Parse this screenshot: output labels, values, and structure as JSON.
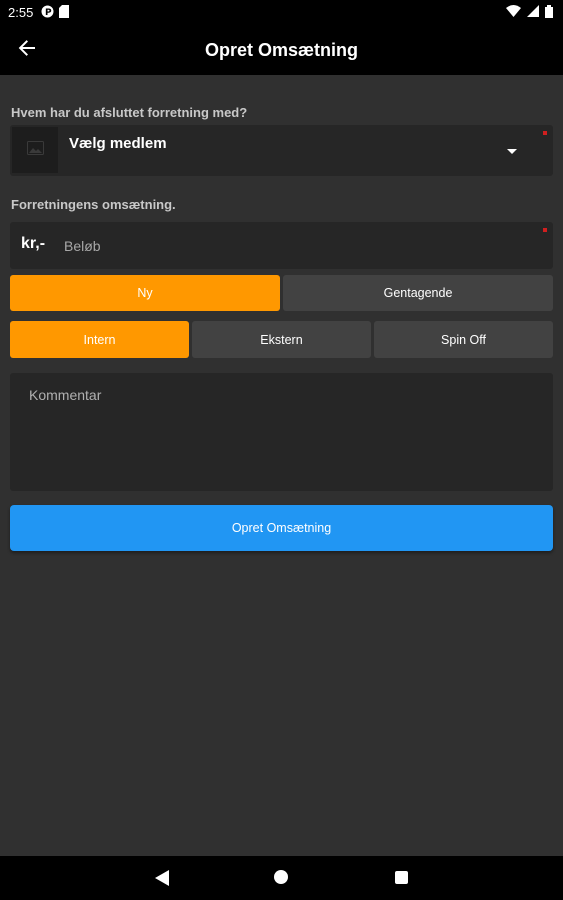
{
  "status_bar": {
    "time": "2:55",
    "icons": [
      "notification-p-icon",
      "sd-card-icon",
      "wifi-icon",
      "signal-icon",
      "battery-icon"
    ]
  },
  "app_bar": {
    "title": "Opret Omsætning",
    "back_icon": "arrow-back-icon"
  },
  "member": {
    "label": "Hvem har du afsluttet forretning med?",
    "select_text": "Vælg medlem",
    "required": true
  },
  "amount": {
    "label": "Forretningens omsætning.",
    "prefix": "kr,-",
    "placeholder": "Beløb",
    "value": "",
    "required": true
  },
  "type_toggle": {
    "options": [
      "Ny",
      "Gentagende"
    ],
    "selected": "Ny"
  },
  "scope_toggle": {
    "options": [
      "Intern",
      "Ekstern",
      "Spin Off"
    ],
    "selected": "Intern"
  },
  "comment": {
    "placeholder": "Kommentar",
    "value": ""
  },
  "submit": {
    "label": "Opret Omsætning"
  },
  "colors": {
    "background": "#303030",
    "field": "#262626",
    "accent_orange": "#ff9800",
    "button_blue": "#2196f3",
    "segment_inactive": "#424242",
    "required_marker": "#d01f1f"
  }
}
